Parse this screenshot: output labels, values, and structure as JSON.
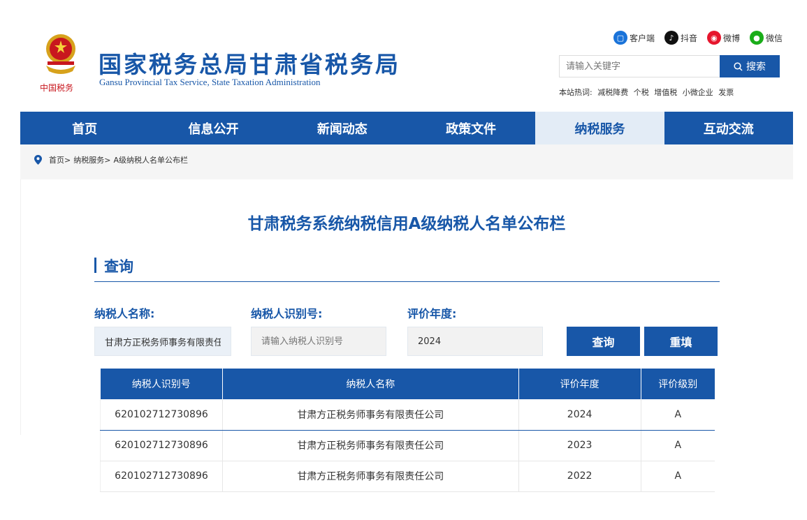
{
  "header": {
    "title": "国家税务总局甘肃省税务局",
    "subtitle": "Gansu Provincial Tax Service, State Taxation Administration",
    "logo_text": "中国税务"
  },
  "social": [
    {
      "label": "客户端",
      "icon": "client-app-icon",
      "color": "#1a73d9"
    },
    {
      "label": "抖音",
      "icon": "douyin-icon",
      "color": "#111111"
    },
    {
      "label": "微博",
      "icon": "weibo-icon",
      "color": "#e6162d"
    },
    {
      "label": "微信",
      "icon": "wechat-icon",
      "color": "#1aad19"
    }
  ],
  "search": {
    "placeholder": "请输入关键字",
    "button": "搜索"
  },
  "hot_words": {
    "label": "本站热词:",
    "items": [
      "减税降费",
      "个税",
      "增值税",
      "小微企业",
      "发票"
    ]
  },
  "nav": {
    "items": [
      "首页",
      "信息公开",
      "新闻动态",
      "政策文件",
      "纳税服务",
      "互动交流"
    ],
    "active": "纳税服务"
  },
  "breadcrumb": [
    "首页>",
    "纳税服务>",
    "A级纳税人名单公布栏"
  ],
  "page": {
    "title": "甘肃税务系统纳税信用A级纳税人名单公布栏",
    "section": "查询"
  },
  "form": {
    "name_label": "纳税人名称:",
    "name_value": "甘肃方正税务师事务有限责任公司",
    "id_label": "纳税人识别号:",
    "id_placeholder": "请输入纳税人识别号",
    "year_label": "评价年度:",
    "year_value": "2024",
    "query_button": "查询",
    "reset_button": "重填"
  },
  "table": {
    "headers": [
      "纳税人识别号",
      "纳税人名称",
      "评价年度",
      "评价级别"
    ],
    "rows": [
      [
        "620102712730896",
        "甘肃方正税务师事务有限责任公司",
        "2024",
        "A"
      ],
      [
        "620102712730896",
        "甘肃方正税务师事务有限责任公司",
        "2023",
        "A"
      ],
      [
        "620102712730896",
        "甘肃方正税务师事务有限责任公司",
        "2022",
        "A"
      ]
    ]
  },
  "colors": {
    "brand": "#1857a8",
    "nav_active_bg": "#e3ecf6"
  }
}
